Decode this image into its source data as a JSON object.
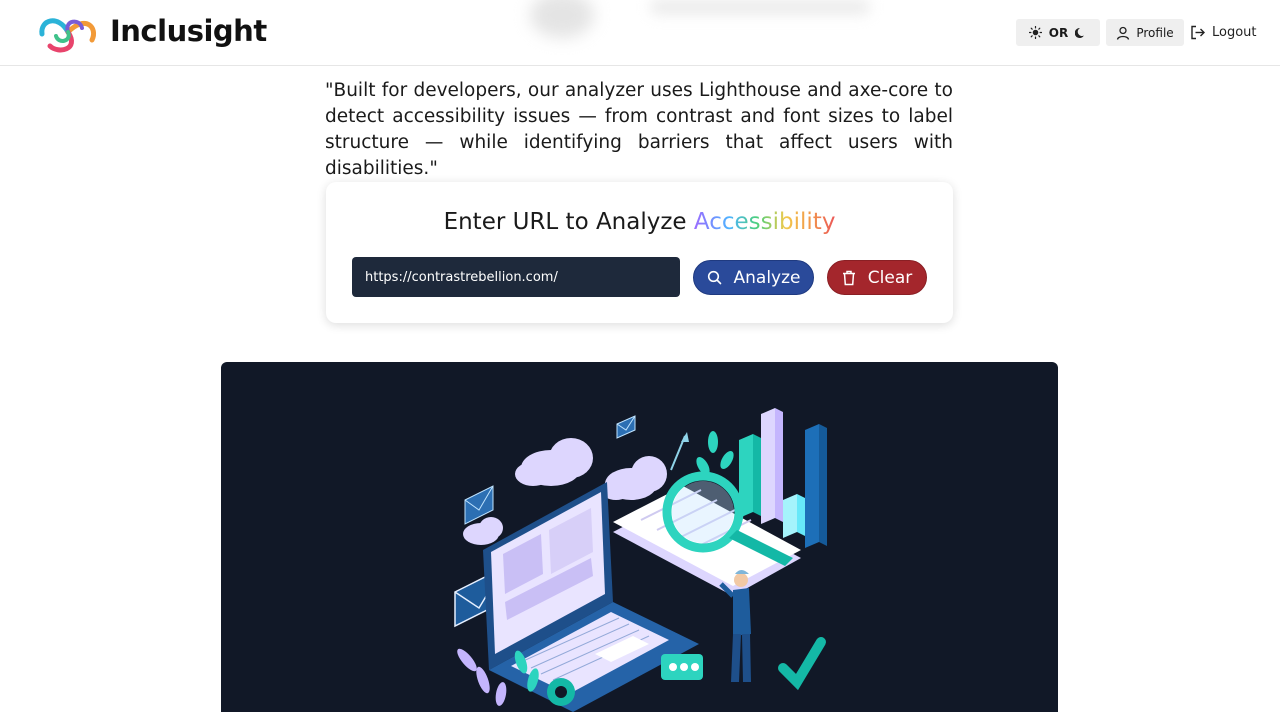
{
  "header": {
    "brand": "Inclusight",
    "theme_toggle": {
      "label": "OR",
      "light_icon": "sun-icon",
      "dark_icon": "moon-icon"
    },
    "profile_label": "Profile",
    "logout_label": "Logout"
  },
  "main": {
    "quote": "\"Built for developers, our analyzer uses Lighthouse and axe-core to detect accessibility issues — from contrast and font sizes to label structure — while identifying barriers that affect users with disabilities.\"",
    "card": {
      "title_prefix": "Enter URL to Analyze",
      "title_highlight": "Accessibility",
      "url_value": "https://contrastrebellion.com/",
      "analyze_label": "Analyze",
      "clear_label": "Clear"
    }
  },
  "colors": {
    "input_bg": "#1e293b",
    "analyze_bg": "#2a4a9a",
    "clear_bg": "#a4262c",
    "hero_bg": "#111827"
  }
}
